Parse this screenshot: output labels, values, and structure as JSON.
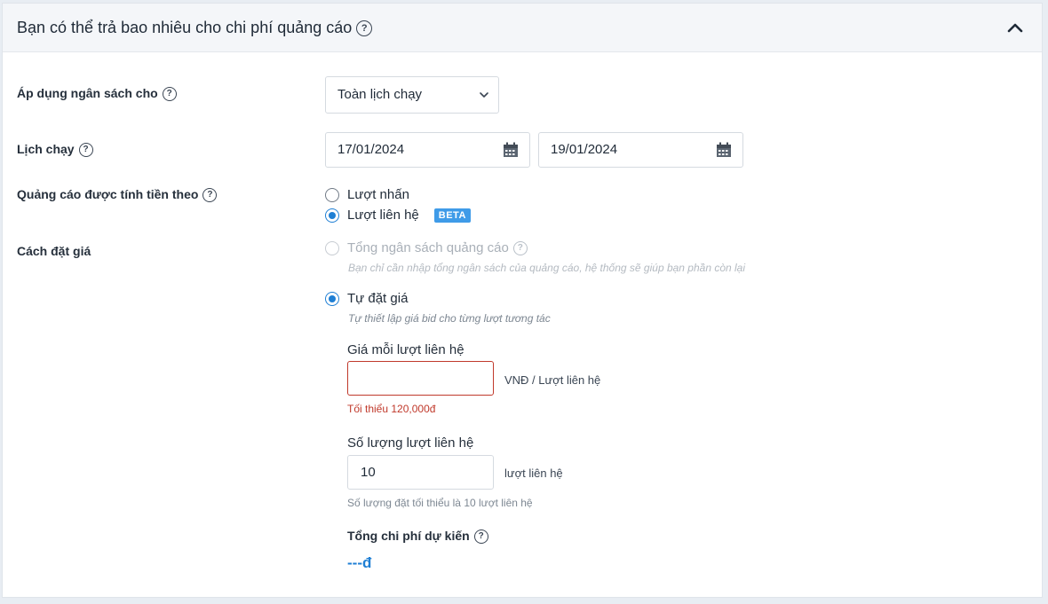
{
  "header": {
    "title": "Bạn có thể trả bao nhiêu cho chi phí quảng cáo"
  },
  "budget_scope": {
    "label": "Áp dụng ngân sách cho",
    "selected": "Toàn lịch chạy"
  },
  "schedule": {
    "label": "Lịch chạy",
    "start_date": "17/01/2024",
    "end_date": "19/01/2024"
  },
  "billing": {
    "label": "Quảng cáo được tính tiền theo",
    "options": [
      {
        "label": "Lượt nhấn",
        "checked": false
      },
      {
        "label": "Lượt liên hệ",
        "checked": true,
        "badge": "BETA"
      }
    ]
  },
  "bidding": {
    "label": "Cách đặt giá",
    "options": [
      {
        "label": "Tổng ngân sách quảng cáo",
        "hint": "Bạn chỉ cần nhập tổng ngân sách của quảng cáo, hệ thống sẽ giúp bạn phần còn lại",
        "checked": false,
        "disabled": true
      },
      {
        "label": "Tự đặt giá",
        "hint": "Tự thiết lập giá bid cho từng lượt tương tác",
        "checked": true,
        "disabled": false
      }
    ],
    "price_per_contact": {
      "label": "Giá mỗi lượt liên hệ",
      "value": "",
      "unit": "VNĐ / Lượt liên hệ",
      "error": "Tối thiểu 120,000đ"
    },
    "contact_count": {
      "label": "Số lượng lượt liên hệ",
      "value": "10",
      "unit": "lượt liên hệ",
      "hint": "Số lượng đặt tối thiểu là 10 lượt liên hệ"
    },
    "total": {
      "label": "Tổng chi phí dự kiến",
      "value": "---đ"
    }
  },
  "colors": {
    "accent": "#1f7fd4",
    "error": "#c0392b",
    "beta_badge": "#3f9be8"
  }
}
